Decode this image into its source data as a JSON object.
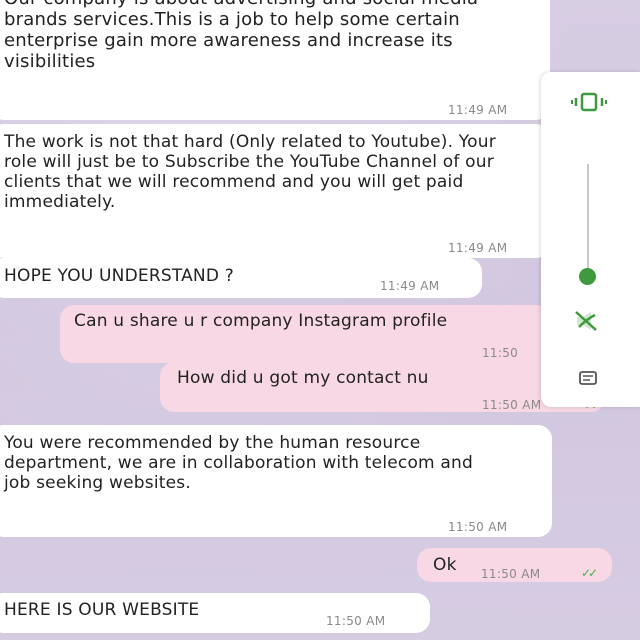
{
  "messages": [
    {
      "dir": "in",
      "text": "Our company is about advertising and social media brands services.This is a job to help some certain enterprise gain more awareness and increase its visibilities",
      "time": "11:49 AM"
    },
    {
      "dir": "in",
      "text": "The work is not that hard (Only related to Youtube). Your role will just be to Subscribe the YouTube Channel of our clients that we will recommend and you will get paid immediately.",
      "time": "11:49 AM"
    },
    {
      "dir": "in",
      "text": "HOPE YOU UNDERSTAND ?",
      "time": "11:49 AM"
    },
    {
      "dir": "out",
      "text": "Can u share u r company Instagram profile",
      "time": "11:50"
    },
    {
      "dir": "out",
      "text": "How did u got my contact nu",
      "time": "11:50 AM",
      "ticks": "✓✓"
    },
    {
      "dir": "in",
      "text": "You were recommended by the human resource department, we are in collaboration with telecom and job seeking websites.",
      "time": "11:50 AM"
    },
    {
      "dir": "out",
      "text": "Ok",
      "time": "11:50 AM",
      "ticks": "✓✓"
    },
    {
      "dir": "in",
      "text": "HERE IS OUR WEBSITE",
      "time": "11:50 AM"
    }
  ],
  "side_panel": {
    "volume_level": 0.0,
    "icons": [
      "vibrate-icon",
      "mute-icon",
      "ringer-settings-icon"
    ]
  },
  "colors": {
    "wallpaper": "#d7cde3",
    "incoming_bubble": "#ffffff",
    "outgoing_bubble": "#f8d8e4",
    "read_ticks": "#4caf50",
    "panel_accent": "#3f9a3f"
  }
}
